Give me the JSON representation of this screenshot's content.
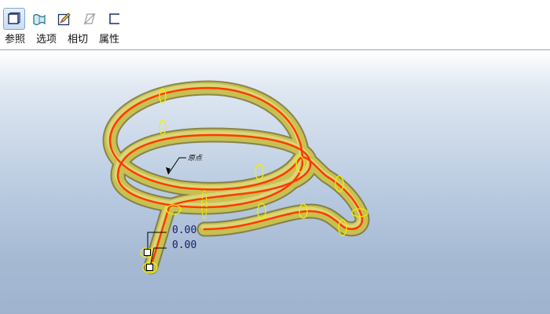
{
  "dashboard": {
    "icons": [
      {
        "name": "reference-icon",
        "active": true
      },
      {
        "name": "surface-icon",
        "active": false
      },
      {
        "name": "sketch-edit-icon",
        "active": false
      },
      {
        "name": "plane-disabled-icon",
        "active": false
      },
      {
        "name": "section-icon",
        "active": false
      }
    ],
    "tabs": [
      "参照",
      "选项",
      "相切",
      "属性"
    ]
  },
  "viewport": {
    "origin_note": "原点",
    "dimensions": [
      "0.00",
      "0.00"
    ]
  },
  "colors": {
    "tube": "#c8c050",
    "centerline": "#ff3a00",
    "section_circle": "#f2ee00",
    "background_top": "#ffffff",
    "background_bottom": "#9fb3cf"
  }
}
